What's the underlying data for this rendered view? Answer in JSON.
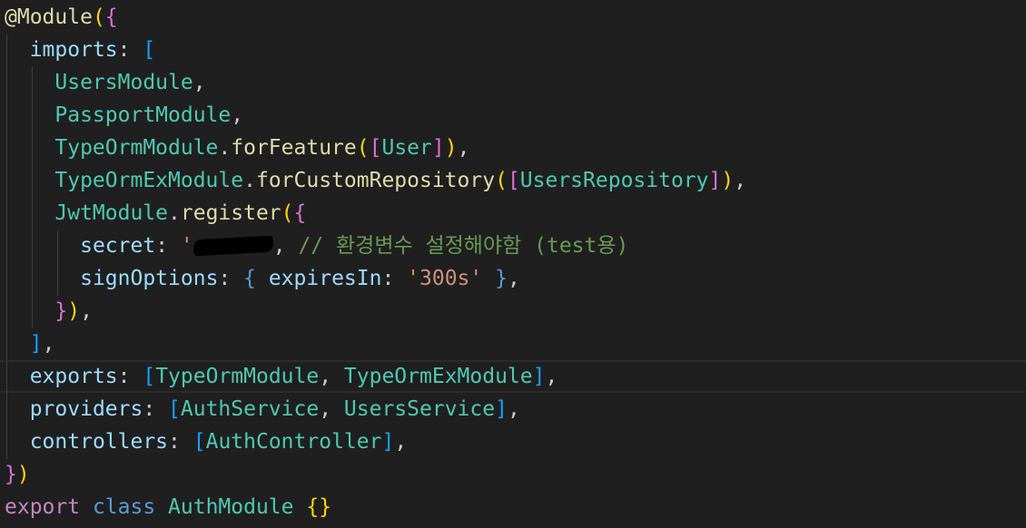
{
  "code": {
    "l1": {
      "decorator": "@Module",
      "open": "(",
      "brace": "{"
    },
    "l2": {
      "key": "imports",
      "colon": ": ",
      "bracket": "["
    },
    "l3": {
      "name": "UsersModule",
      "comma": ","
    },
    "l4": {
      "name": "PassportModule",
      "comma": ","
    },
    "l5": {
      "name": "TypeOrmModule",
      "dot": ".",
      "method": "forFeature",
      "open": "(",
      "bracket": "[",
      "arg": "User",
      "bracket_close": "]",
      "close": ")",
      "comma": ","
    },
    "l6": {
      "name": "TypeOrmExModule",
      "dot": ".",
      "method": "forCustomRepository",
      "open": "(",
      "bracket": "[",
      "arg": "UsersRepository",
      "bracket_close": "]",
      "close": ")",
      "comma": ","
    },
    "l7": {
      "name": "JwtModule",
      "dot": ".",
      "method": "register",
      "open": "(",
      "brace": "{"
    },
    "l8": {
      "key": "secret",
      "colon": ": ",
      "quote": "'",
      "comma": ", ",
      "comment": "// 환경변수 설정해야함 (test용)"
    },
    "l9": {
      "key": "signOptions",
      "colon": ": ",
      "brace": "{",
      "inner_key": " expiresIn",
      "inner_colon": ": ",
      "value": "'300s'",
      "brace_close": " }",
      "comma": ","
    },
    "l10": {
      "brace": "}",
      "paren": ")",
      "comma": ","
    },
    "l11": {
      "bracket": "]",
      "comma": ","
    },
    "l12": {
      "key": "exports",
      "colon": ": ",
      "bracket": "[",
      "a": "TypeOrmModule",
      "sep": ", ",
      "b": "TypeOrmExModule",
      "bracket_close": "]",
      "comma": ","
    },
    "l13": {
      "key": "providers",
      "colon": ": ",
      "bracket": "[",
      "a": "AuthService",
      "sep": ", ",
      "b": "UsersService",
      "bracket_close": "]",
      "comma": ","
    },
    "l14": {
      "key": "controllers",
      "colon": ": ",
      "bracket": "[",
      "a": "AuthController",
      "bracket_close": "]",
      "comma": ","
    },
    "l15": {
      "brace": "}",
      "paren": ")"
    },
    "l16": {
      "kw_export": "export",
      "kw_class": " class",
      "name": " AuthModule ",
      "braces": "{}"
    }
  },
  "colors": {
    "background": "#1f1f1f",
    "decorator": "#dcdcaa",
    "property": "#9cdcfe",
    "class": "#4ec9b0",
    "string": "#ce9178",
    "comment": "#6a9955",
    "keyword": "#c586c0",
    "storage": "#569cd6"
  }
}
